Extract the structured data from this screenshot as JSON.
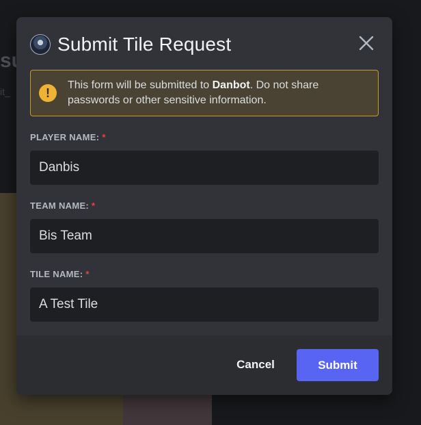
{
  "background": {
    "heading": "su",
    "subtext": "it_"
  },
  "modal": {
    "title": "Submit Tile Request",
    "app_avatar_icon": "user-avatar-icon",
    "close_icon": "close-icon"
  },
  "notice": {
    "icon": "warning-icon",
    "icon_glyph": "!",
    "text_before": "This form will be submitted to ",
    "app_name": "Danbot",
    "text_after": ". Do not share passwords or other sensitive information."
  },
  "fields": [
    {
      "label": "PLAYER NAME:",
      "required_mark": "*",
      "value": "Danbis"
    },
    {
      "label": "TEAM NAME:",
      "required_mark": "*",
      "value": "Bis Team"
    },
    {
      "label": "TILE NAME:",
      "required_mark": "*",
      "value": "A Test Tile"
    }
  ],
  "footer": {
    "cancel_label": "Cancel",
    "submit_label": "Submit"
  },
  "colors": {
    "accent": "#5865f2",
    "warning": "#f0b232",
    "required": "#f23f43",
    "modal_bg": "#313338",
    "input_bg": "#1e1f22"
  }
}
